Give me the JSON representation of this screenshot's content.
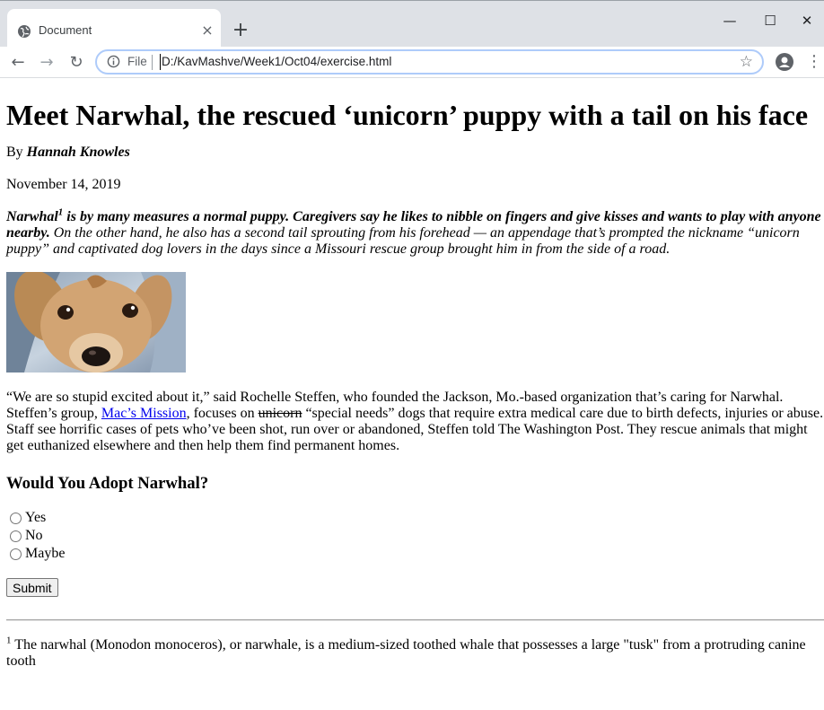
{
  "browser": {
    "tab_title": "Document",
    "tab_close": "×",
    "new_tab": "+",
    "scheme_label": "File",
    "url": "D:/KavMashve/Week1/Oct04/exercise.html",
    "star_icon": "bookmark-star-icon",
    "window_controls": {
      "minimize": "—",
      "maximize": "☐",
      "close": "✕"
    }
  },
  "nav": {
    "back": "←",
    "forward": "→",
    "reload": "↻",
    "star": "☆",
    "menu": "⋮"
  },
  "article": {
    "title": "Meet Narwhal, the rescued ‘unicorn’ puppy with a tail on his face",
    "by_label": "By",
    "author": "Hannah Knowles",
    "date": "November 14, 2019",
    "lede_subject": "Narwhal",
    "lede_sup": "1",
    "lede_bold": " is by many measures a normal puppy. Caregivers say he likes to nibble on fingers and give kisses and wants to play with anyone nearby.",
    "lede_rest": " On the other hand, he also has a second tail sprouting from his forehead — an appendage that’s prompted the nickname “unicorn puppy” and captivated dog lovers in the days since a Missouri rescue group brought him in from the side of a road.",
    "para1": "“We are so stupid excited about it,” said Rochelle Steffen, who founded the Jackson, Mo.-based organization that’s caring for Narwhal. Steffen’s group, ",
    "link_text": "Mac’s Mission",
    "para2": ", focuses on ",
    "struck": "unicorn",
    "para3": " “special needs” dogs that require extra medical care due to birth defects, injuries or abuse. Staff see horrific cases of pets who’ve been shot, run over or abandoned, Steffen told The Washington Post. They rescue animals that might get euthanized elsewhere and then help them find permanent homes."
  },
  "poll": {
    "question": "Would You Adopt Narwhal?",
    "options": [
      "Yes",
      "No",
      "Maybe"
    ],
    "submit": "Submit"
  },
  "footnote": {
    "marker": "1",
    "text": " The narwhal (Monodon monoceros), or narwhale, is a medium-sized toothed whale that possesses a large \"tusk\" from a protruding canine tooth"
  },
  "colors": {
    "link": "#0000ee",
    "tabstrip": "#dee1e6",
    "omnibox_border": "#aecbfa"
  }
}
